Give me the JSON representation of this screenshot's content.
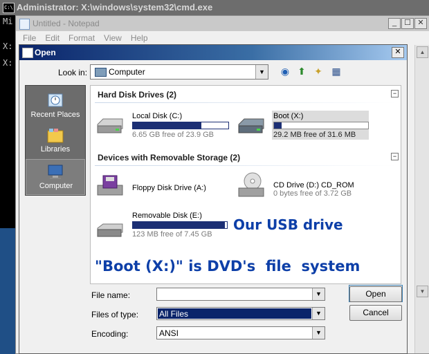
{
  "cmd": {
    "title": "Administrator: X:\\windows\\system32\\cmd.exe",
    "lines": [
      "Mi",
      "X:",
      "X:"
    ]
  },
  "notepad": {
    "title": "Untitled - Notepad",
    "menu": [
      "File",
      "Edit",
      "Format",
      "View",
      "Help"
    ],
    "controls": {
      "minimize": "_",
      "maximize": "☐",
      "close": "✕"
    }
  },
  "dialog": {
    "title": "Open",
    "close_label": "✕",
    "look_in_label": "Look in:",
    "look_in_value": "Computer",
    "places": [
      {
        "label": "Recent Places",
        "icon": "recent-places-icon"
      },
      {
        "label": "Libraries",
        "icon": "libraries-icon"
      },
      {
        "label": "Computer",
        "icon": "computer-icon"
      }
    ],
    "groups": [
      {
        "header": "Hard Disk Drives (2)",
        "items": [
          {
            "name": "Local Disk (C:)",
            "free": "6.65 GB free of 23.9 GB",
            "used_fraction": 0.72
          },
          {
            "name": "Boot (X:)",
            "free": "29.2 MB free of 31.6 MB",
            "used_fraction": 0.08
          }
        ]
      },
      {
        "header": "Devices with Removable Storage (2)",
        "items": [
          {
            "name": "Floppy Disk Drive (A:)"
          },
          {
            "name": "CD Drive (D:) CD_ROM",
            "free": "0 bytes free of 3.72 GB"
          },
          {
            "name": "Removable Disk (E:)",
            "free": "123 MB free of 7.45 GB",
            "used_fraction": 0.98
          }
        ]
      }
    ],
    "annotations": {
      "usb": "Our USB drive",
      "boot": "\"Boot (X:)\" is DVD's  file  system"
    },
    "file_name_label": "File name:",
    "file_name_value": "",
    "files_of_type_label": "Files of type:",
    "files_of_type_value": "All Files",
    "encoding_label": "Encoding:",
    "encoding_value": "ANSI",
    "open_label": "Open",
    "cancel_label": "Cancel"
  },
  "colors": {
    "progress": "#1c2f74",
    "annotation": "#0d3fa8",
    "selection": "#0a246a"
  }
}
